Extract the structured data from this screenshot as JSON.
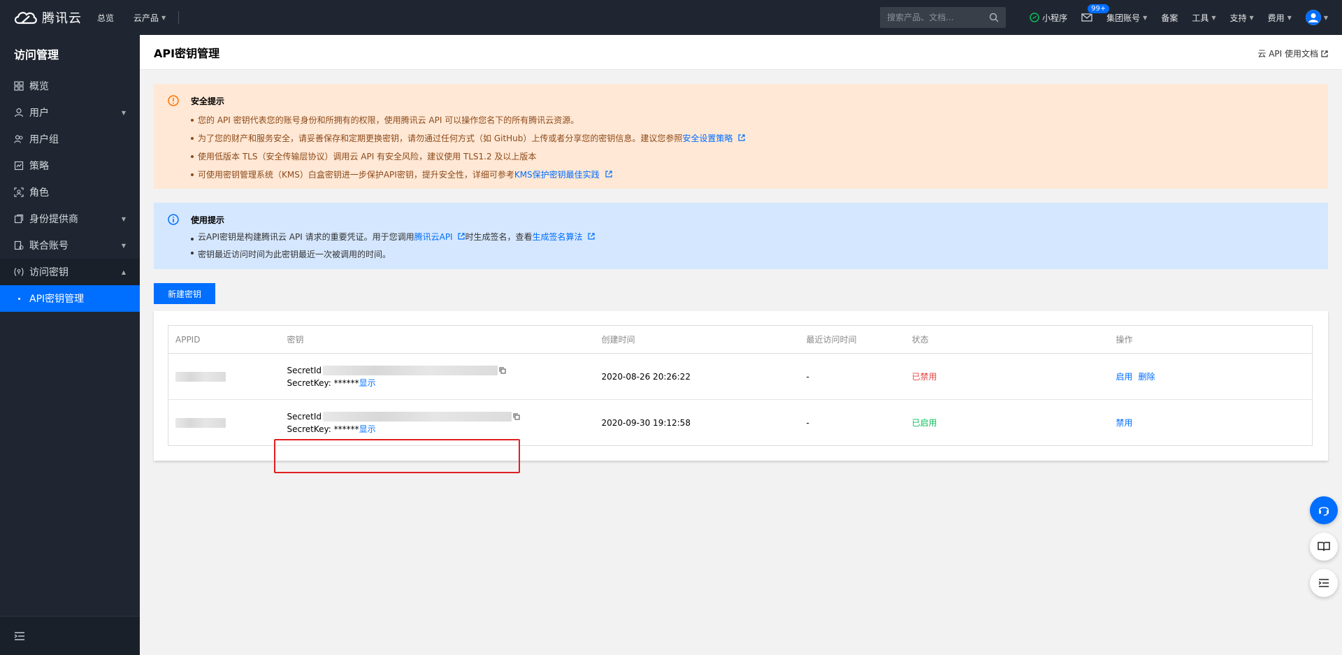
{
  "topbar": {
    "brand": "腾讯云",
    "nav": [
      "总览",
      "云产品"
    ],
    "search_placeholder": "搜索产品、文档...",
    "mini_program": "小程序",
    "mail_badge": "99+",
    "group_account": "集团账号",
    "record": "备案",
    "tools": "工具",
    "support": "支持",
    "billing": "费用"
  },
  "sidebar": {
    "title": "访问管理",
    "items": [
      {
        "label": "概览"
      },
      {
        "label": "用户"
      },
      {
        "label": "用户组"
      },
      {
        "label": "策略"
      },
      {
        "label": "角色"
      },
      {
        "label": "身份提供商"
      },
      {
        "label": "联合账号"
      },
      {
        "label": "访问密钥"
      }
    ],
    "sub_item": "API密钥管理"
  },
  "page": {
    "title": "API密钥管理",
    "doc_link": "云 API 使用文档"
  },
  "security_tip": {
    "title": "安全提示",
    "line1": "您的 API 密钥代表您的账号身份和所拥有的权限，使用腾讯云 API 可以操作您名下的所有腾讯云资源。",
    "line2_text": "为了您的财产和服务安全，请妥善保存和定期更换密钥，请勿通过任何方式（如 GitHub）上传或者分享您的密钥信息。建议您参照",
    "line2_link": "安全设置策略",
    "line3": "使用低版本 TLS（安全传输层协议）调用云 API 有安全风险，建议使用 TLS1.2 及以上版本",
    "line4_text": "可使用密钥管理系统（KMS）白盒密钥进一步保护API密钥，提升安全性，详细可参考",
    "line4_link": "KMS保护密钥最佳实践"
  },
  "usage_tip": {
    "title": "使用提示",
    "line1_a": "云API密钥是构建腾讯云 API 请求的重要凭证。用于您调用",
    "line1_link1": "腾讯云API",
    "line1_b": "时生成签名，查看",
    "line1_link2": "生成签名算法",
    "line2": "密钥最近访问时间为此密钥最近一次被调用的时间。"
  },
  "new_key_button": "新建密钥",
  "table": {
    "headers": [
      "APPID",
      "密钥",
      "创建时间",
      "最近访问时间",
      "状态",
      "操作"
    ],
    "secret_id_label": "SecretId",
    "secret_key_label": "SecretKey: ******",
    "show_label": "显示",
    "rows": [
      {
        "created": "2020-08-26 20:26:22",
        "last_access": "-",
        "status": "已禁用",
        "op1": "启用",
        "op2": "删除"
      },
      {
        "created": "2020-09-30 19:12:58",
        "last_access": "-",
        "status": "已启用",
        "op1": "禁用",
        "op2": ""
      }
    ]
  },
  "colors": {
    "accent": "#006eff",
    "topbar_bg": "#1f2631",
    "warn_bg": "#ffe8d5",
    "info_bg": "#d5e7ff",
    "disabled": "#e54545",
    "enabled": "#0abf5b",
    "highlight": "#e02020"
  }
}
